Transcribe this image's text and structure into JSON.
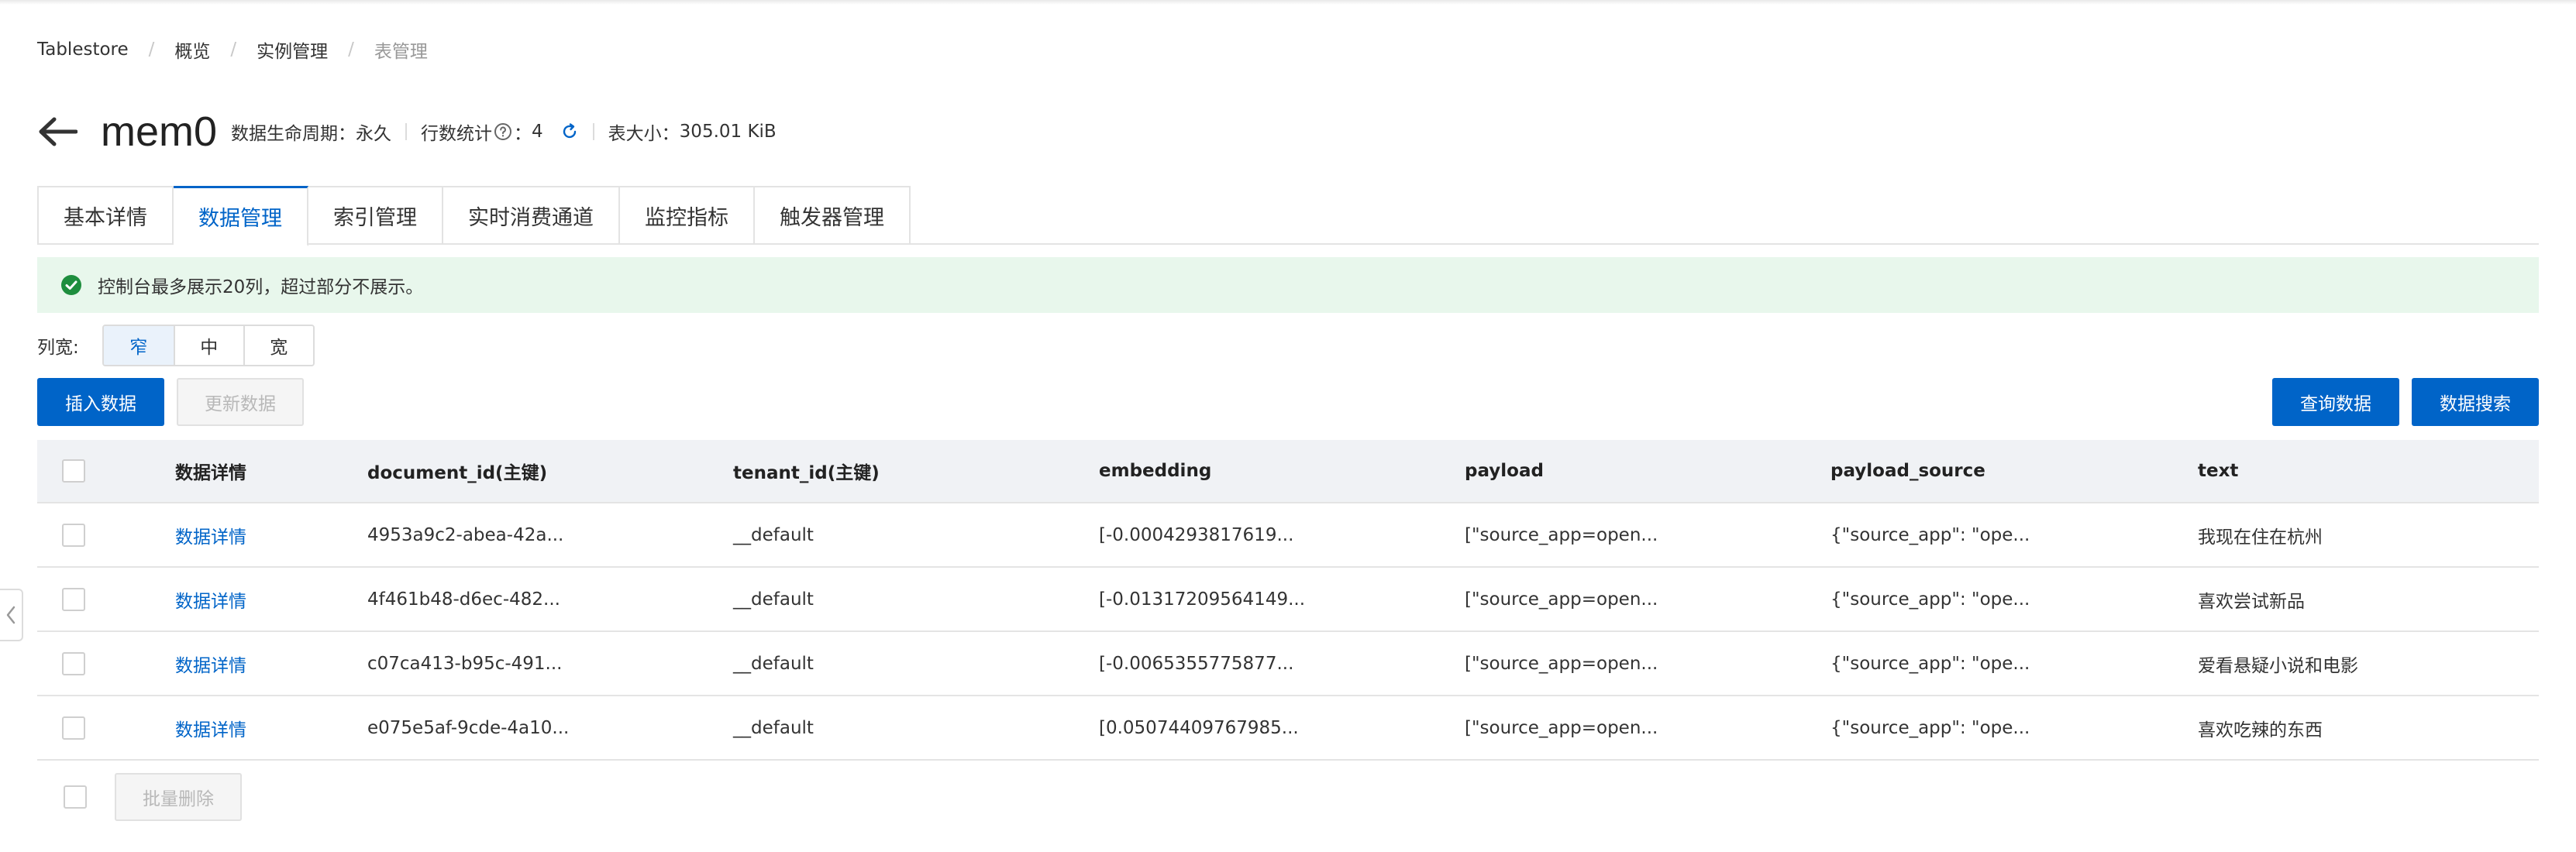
{
  "breadcrumb": [
    "Tablestore",
    "概览",
    "实例管理",
    "表管理"
  ],
  "header": {
    "title": "mem0",
    "ttl_label": "数据生命周期：",
    "ttl_value": "永久",
    "row_count_label": "行数统计",
    "row_count_colon": "：",
    "row_count_value": "4",
    "size_label": "表大小：",
    "size_value": "305.01 KiB"
  },
  "tabs": [
    "基本详情",
    "数据管理",
    "索引管理",
    "实时消费通道",
    "监控指标",
    "触发器管理"
  ],
  "active_tab": "数据管理",
  "banner": {
    "text": "控制台最多展示20列，超过部分不展示。"
  },
  "column_width": {
    "label": "列宽:",
    "options": [
      "窄",
      "中",
      "宽"
    ],
    "selected": "窄"
  },
  "buttons": {
    "insert": "插入数据",
    "update": "更新数据",
    "query": "查询数据",
    "search": "数据搜索",
    "batch_delete": "批量删除"
  },
  "table": {
    "columns": [
      "数据详情",
      "document_id(主键)",
      "tenant_id(主键)",
      "embedding",
      "payload",
      "payload_source",
      "text"
    ],
    "rows": [
      {
        "detail": "数据详情",
        "document_id": "4953a9c2-abea-42a...",
        "tenant_id": "__default",
        "embedding": "[-0.0004293817619...",
        "payload": "[\"source_app=open...",
        "payload_source": "{\"source_app\": \"ope...",
        "text": "我现在住在杭州"
      },
      {
        "detail": "数据详情",
        "document_id": "4f461b48-d6ec-482...",
        "tenant_id": "__default",
        "embedding": "[-0.01317209564149...",
        "payload": "[\"source_app=open...",
        "payload_source": "{\"source_app\": \"ope...",
        "text": "喜欢尝试新品"
      },
      {
        "detail": "数据详情",
        "document_id": "c07ca413-b95c-491...",
        "tenant_id": "__default",
        "embedding": "[-0.0065355775877...",
        "payload": "[\"source_app=open...",
        "payload_source": "{\"source_app\": \"ope...",
        "text": "爱看悬疑小说和电影"
      },
      {
        "detail": "数据详情",
        "document_id": "e075e5af-9cde-4a10...",
        "tenant_id": "__default",
        "embedding": "[0.05074409767985...",
        "payload": "[\"source_app=open...",
        "payload_source": "{\"source_app\": \"ope...",
        "text": "喜欢吃辣的东西"
      }
    ]
  },
  "colors": {
    "accent": "#0064c8",
    "banner_bg": "#e8f7ec",
    "success": "#1e8e3e"
  }
}
